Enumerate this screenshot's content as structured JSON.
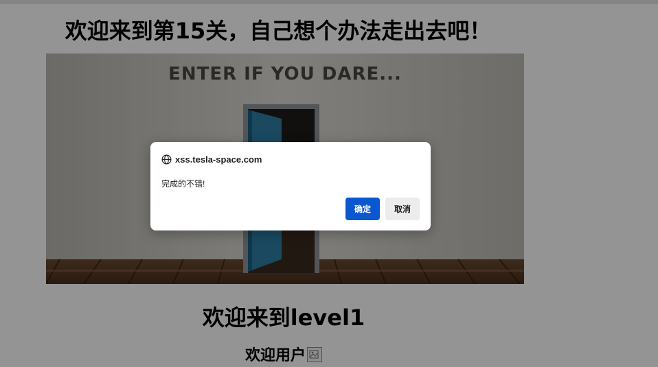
{
  "page": {
    "heading": "欢迎来到第15关，自己想个办法走出去吧！",
    "hero_image_text": "ENTER IF YOU DARE...",
    "level_title": "欢迎来到level1",
    "welcome_user": "欢迎用户"
  },
  "dialog": {
    "origin": "xss.tesla-space.com",
    "message": "完成的不错!",
    "ok_label": "确定",
    "cancel_label": "取消"
  },
  "colors": {
    "ok_button": "#0b57d0",
    "cancel_button": "#ececec",
    "overlay": "rgba(0,0,0,0.42)"
  },
  "icons": {
    "origin": "globe-icon",
    "user_image": "broken-image-icon"
  }
}
